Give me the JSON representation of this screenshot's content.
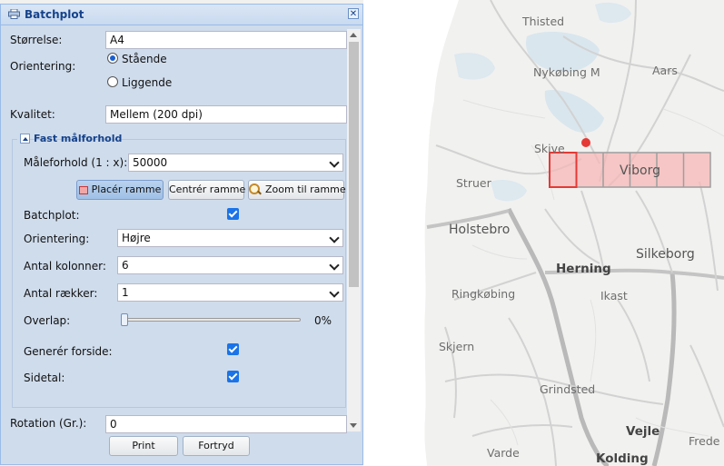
{
  "panel": {
    "title": "Batchplot",
    "fields": {
      "size_label": "Størrelse:",
      "size_value": "A4",
      "orientation_label": "Orientering:",
      "orientation_options": [
        "Stående",
        "Liggende"
      ],
      "orientation_selected": "Stående",
      "quality_label": "Kvalitet:",
      "quality_value": "Mellem (200 dpi)"
    },
    "fixed_scale": {
      "legend": "Fast målforhold",
      "scale_label": "Måleforhold (1 : x):",
      "scale_value": "50000",
      "buttons": {
        "place": "Placér ramme",
        "center": "Centrér ramme",
        "zoom": "Zoom til ramme"
      },
      "batchplot_label": "Batchplot:",
      "batchplot_checked": true,
      "orientation_label": "Orientering:",
      "orientation_value": "Højre",
      "columns_label": "Antal kolonner:",
      "columns_value": "6",
      "rows_label": "Antal rækker:",
      "rows_value": "1",
      "overlap_label": "Overlap:",
      "overlap_value": "0%",
      "overlap_percent": 0,
      "cover_label": "Generér forside:",
      "cover_checked": true,
      "pagenum_label": "Sidetal:",
      "pagenum_checked": true
    },
    "rotation_label": "Rotation (Gr.):",
    "rotation_value": "0",
    "print_button": "Print",
    "cancel_button": "Fortryd"
  },
  "map": {
    "towns": {
      "thisted": "Thisted",
      "nykobing": "Nykøbing M",
      "aars": "Aars",
      "skive": "Skive",
      "struer": "Struer",
      "viborg": "Viborg",
      "holstebro": "Holstebro",
      "herning": "Herning",
      "silkeborg": "Silkeborg",
      "ringkobing": "Ringkøbing",
      "ikast": "Ikast",
      "skjern": "Skjern",
      "grindsted": "Grindsted",
      "vejle": "Vejle",
      "varde": "Varde",
      "kolding": "Kolding",
      "fredericia": "Frede"
    },
    "frame_color": "#e53935"
  }
}
